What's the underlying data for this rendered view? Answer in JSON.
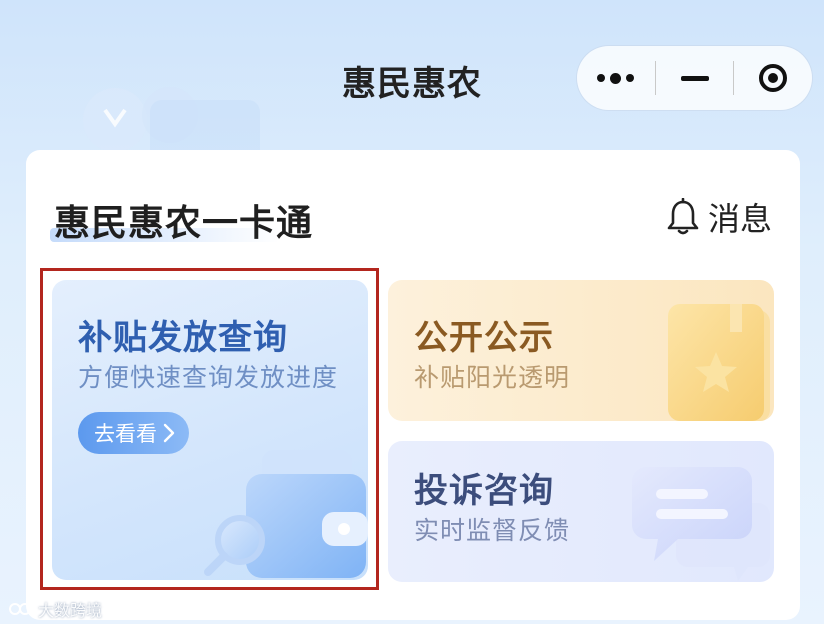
{
  "header": {
    "title": "惠民惠农"
  },
  "capsule": {
    "more_icon": "more-dots-icon",
    "minimize_icon": "minimize-icon",
    "close_icon": "close-target-icon"
  },
  "card": {
    "title": "惠民惠农一卡通",
    "message_label": "消息",
    "message_icon": "bell-icon"
  },
  "tiles": [
    {
      "heading": "补贴发放查询",
      "subtitle": "方便快速查询发放进度",
      "button_label": "去看看",
      "button_icon": "chevron-right-icon",
      "illustration": "wallet-search-icon"
    },
    {
      "heading": "公开公示",
      "subtitle": "补贴阳光透明",
      "illustration": "star-book-icon"
    },
    {
      "heading": "投诉咨询",
      "subtitle": "实时监督反馈",
      "illustration": "chat-bubbles-icon"
    }
  ],
  "watermark": {
    "text": "大数跨境"
  },
  "colors": {
    "highlight_border": "#b3261e",
    "subsidy_heading": "#2f5fb0",
    "public_heading": "#8a5a22",
    "complaint_heading": "#3c4d7c",
    "button_bg": "#5c99ee"
  }
}
